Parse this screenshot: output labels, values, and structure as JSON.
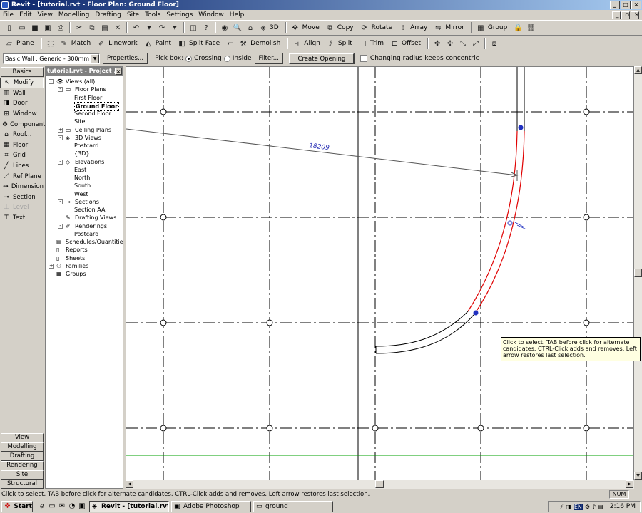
{
  "window": {
    "title": "Revit - [tutorial.rvt - Floor Plan: Ground Floor]"
  },
  "menu": [
    "File",
    "Edit",
    "View",
    "Modelling",
    "Drafting",
    "Site",
    "Tools",
    "Settings",
    "Window",
    "Help"
  ],
  "toolbar2": {
    "three_d": "3D",
    "move": "Move",
    "copy": "Copy",
    "rotate": "Rotate",
    "array": "Array",
    "mirror": "Mirror",
    "group": "Group"
  },
  "toolbar3": {
    "plane": "Plane",
    "match": "Match",
    "linework": "Linework",
    "paint": "Paint",
    "split_face": "Split Face",
    "demolish": "Demolish",
    "align": "Align",
    "split": "Split",
    "trim": "Trim",
    "offset": "Offset"
  },
  "options": {
    "type_selector": "Basic Wall : Generic - 300mm",
    "properties": "Properties...",
    "pick_box": "Pick box:",
    "crossing": "Crossing",
    "inside": "Inside",
    "filter": "Filter...",
    "create_opening": "Create Opening",
    "concentric": "Changing radius keeps concentric"
  },
  "design_bar": {
    "active_tab": "Basics",
    "tools": [
      {
        "label": "Modify",
        "icon": "arrow-icon",
        "selected": true,
        "disabled": false
      },
      {
        "label": "Wall",
        "icon": "wall-icon",
        "selected": false,
        "disabled": false
      },
      {
        "label": "Door",
        "icon": "door-icon",
        "selected": false,
        "disabled": false
      },
      {
        "label": "Window",
        "icon": "window-icon",
        "selected": false,
        "disabled": false
      },
      {
        "label": "Component",
        "icon": "component-icon",
        "selected": false,
        "disabled": false
      },
      {
        "label": "Roof...",
        "icon": "roof-icon",
        "selected": false,
        "disabled": false
      },
      {
        "label": "Floor",
        "icon": "floor-icon",
        "selected": false,
        "disabled": false
      },
      {
        "label": "Grid",
        "icon": "grid-icon",
        "selected": false,
        "disabled": false
      },
      {
        "label": "Lines",
        "icon": "lines-icon",
        "selected": false,
        "disabled": false
      },
      {
        "label": "Ref Plane",
        "icon": "ref-plane-icon",
        "selected": false,
        "disabled": false
      },
      {
        "label": "Dimension",
        "icon": "dimension-icon",
        "selected": false,
        "disabled": false
      },
      {
        "label": "Section",
        "icon": "section-icon",
        "selected": false,
        "disabled": false
      },
      {
        "label": "Level",
        "icon": "level-icon",
        "selected": false,
        "disabled": true
      },
      {
        "label": "Text",
        "icon": "text-icon",
        "selected": false,
        "disabled": false
      }
    ],
    "bottom_tabs": [
      "View",
      "Modelling",
      "Drafting",
      "Rendering",
      "Site",
      "Structural"
    ]
  },
  "project_browser": {
    "title": "tutorial.rvt - Project ...",
    "nodes": [
      {
        "label": "Views (all)",
        "level": 0,
        "expander": "-",
        "icon": "eye-icon"
      },
      {
        "label": "Floor Plans",
        "level": 1,
        "expander": "-",
        "icon": "plan-icon"
      },
      {
        "label": "First Floor",
        "level": 2
      },
      {
        "label": "Ground Floor",
        "level": 2,
        "bold": true
      },
      {
        "label": "Second Floor",
        "level": 2
      },
      {
        "label": "Site",
        "level": 2
      },
      {
        "label": "Ceiling Plans",
        "level": 1,
        "expander": "+",
        "icon": "plan-icon"
      },
      {
        "label": "3D Views",
        "level": 1,
        "expander": "-",
        "icon": "cube-icon"
      },
      {
        "label": "Postcard",
        "level": 2
      },
      {
        "label": "{3D}",
        "level": 2
      },
      {
        "label": "Elevations",
        "level": 1,
        "expander": "-",
        "icon": "elevation-icon"
      },
      {
        "label": "East",
        "level": 2
      },
      {
        "label": "North",
        "level": 2
      },
      {
        "label": "South",
        "level": 2
      },
      {
        "label": "West",
        "level": 2
      },
      {
        "label": "Sections",
        "level": 1,
        "expander": "-",
        "icon": "section-icon"
      },
      {
        "label": "Section AA",
        "level": 2
      },
      {
        "label": "Drafting Views",
        "level": 1,
        "icon": "drafting-icon"
      },
      {
        "label": "Renderings",
        "level": 1,
        "expander": "-",
        "icon": "render-icon"
      },
      {
        "label": "Postcard",
        "level": 2
      },
      {
        "label": "Schedules/Quantities",
        "level": 0,
        "icon": "schedule-icon"
      },
      {
        "label": "Reports",
        "level": 0,
        "icon": "report-icon"
      },
      {
        "label": "Sheets",
        "level": 0,
        "icon": "sheet-icon"
      },
      {
        "label": "Families",
        "level": 0,
        "expander": "+",
        "icon": "family-icon"
      },
      {
        "label": "Groups",
        "level": 0,
        "icon": "group-icon"
      }
    ]
  },
  "canvas": {
    "dimension_text": "18209"
  },
  "tooltip": "Click to select. TAB before click for alternate candidates. CTRL-Click adds and removes. Left arrow restores last selection.",
  "status": {
    "text": "Click to select. TAB before click for alternate candidates. CTRL-Click adds and removes. Left arrow restores last selection.",
    "num": "NUM"
  },
  "taskbar": {
    "start": "Start",
    "items": [
      {
        "label": "Revit - [tutorial.rvt ...",
        "active": true
      },
      {
        "label": "Adobe Photoshop",
        "active": false
      },
      {
        "label": "ground",
        "active": false
      }
    ],
    "lang": "EN",
    "clock": "2:16 PM"
  },
  "colors": {
    "selected_wall": "#e00000",
    "grip": "#2030c0",
    "green_line": "#00a000"
  }
}
